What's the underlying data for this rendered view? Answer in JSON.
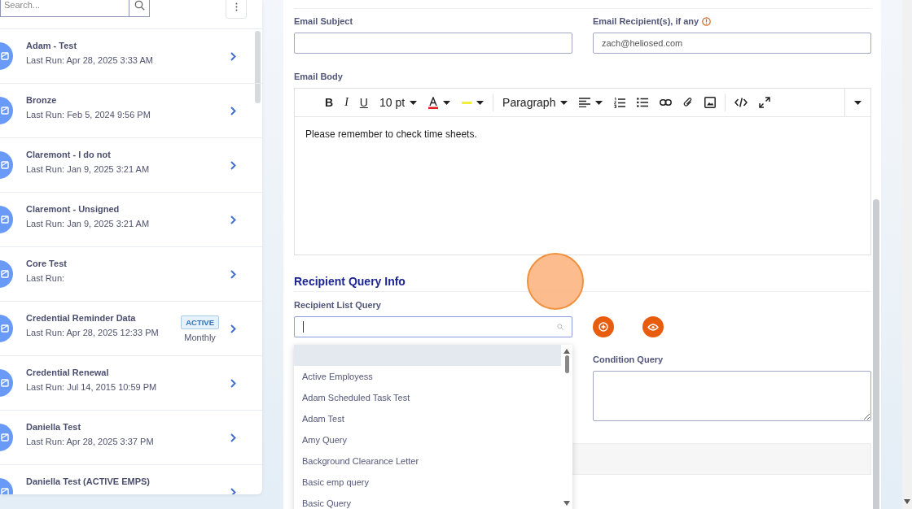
{
  "sidebar": {
    "search": {
      "placeholder": "Search..."
    },
    "items": [
      {
        "name": "Adam - Test",
        "last_run": "Last Run: Apr 28, 2025 3:33 AM"
      },
      {
        "name": "Bronze",
        "last_run": "Last Run: Feb 5, 2024 9:56 PM"
      },
      {
        "name": "Claremont - I do not",
        "last_run": "Last Run: Jan 9, 2025 3:21 AM"
      },
      {
        "name": "Claremont - Unsigned",
        "last_run": "Last Run: Jan 9, 2025 3:21 AM"
      },
      {
        "name": "Core Test",
        "last_run": "Last Run:"
      },
      {
        "name": "Credential Reminder Data",
        "last_run": "Last Run: Apr 28, 2025 12:33 PM",
        "badge": "ACTIVE",
        "frequency": "Monthly"
      },
      {
        "name": "Credential Renewal",
        "last_run": "Last Run: Jul 14, 2015 10:59 PM"
      },
      {
        "name": "Daniella Test",
        "last_run": "Last Run: Apr 28, 2025 3:37 PM"
      },
      {
        "name": "Daniella Test (ACTIVE EMPS)"
      }
    ]
  },
  "form": {
    "subject_label": "Email Subject",
    "recipient_label": "Email Recipient(s), if any",
    "recipient_value": "zach@heliosed.com",
    "body_label": "Email Body",
    "toolbar": {
      "bold": "B",
      "italic": "I",
      "underline": "U",
      "font_size": "10 pt",
      "block_format": "Paragraph"
    },
    "body_text": "Please remember to check time sheets.",
    "query_title": "Recipient Query Info",
    "list_label": "Recipient List Query",
    "condition_label": "Condition Query",
    "dropdown": {
      "blank_option_selected": true,
      "options": [
        {
          "label": "Active Employess",
          "selected": false
        },
        {
          "label": "Adam Scheduled Task Test",
          "selected": false
        },
        {
          "label": "Adam Test",
          "selected": false
        },
        {
          "label": "Amy Query",
          "selected": false
        },
        {
          "label": "Background Clearance Letter",
          "selected": false
        },
        {
          "label": "Basic emp query",
          "selected": false
        },
        {
          "label": "Basic Query",
          "selected": false
        }
      ]
    }
  }
}
